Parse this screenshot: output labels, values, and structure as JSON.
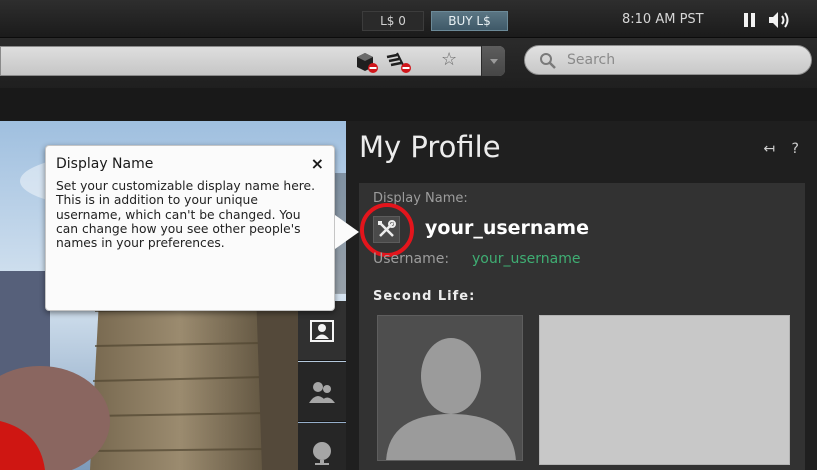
{
  "topbar": {
    "balance": "L$ 0",
    "buy_label": "BUY L$",
    "time": "8:10 AM PST",
    "pause_icon": "pause-icon",
    "volume_icon": "speaker-volume-icon"
  },
  "navbar": {
    "search_placeholder": "Search",
    "icons": [
      "no-build-icon",
      "no-push-icon",
      "star-icon",
      "chevron-down-icon"
    ]
  },
  "tooltip": {
    "title": "Display Name",
    "close": "×",
    "body": "Set your customizable display name here. This is in addition to your unique username, which can't be changed. You can change how you see other people's names in your preferences."
  },
  "sidebar": {
    "tabs": [
      "me-tab",
      "people-tab",
      "places-tab"
    ]
  },
  "profile": {
    "title": "My Profile",
    "controls": "↤ ?",
    "display_name_label": "Display Name:",
    "display_name": "your_username",
    "username_label": "Username:",
    "username": "your_username",
    "second_life_label": "Second Life:"
  },
  "colors": {
    "panel": "#1f1f1f",
    "card": "#323232",
    "username_green": "#3fae73",
    "highlight_red": "#e3151c"
  }
}
